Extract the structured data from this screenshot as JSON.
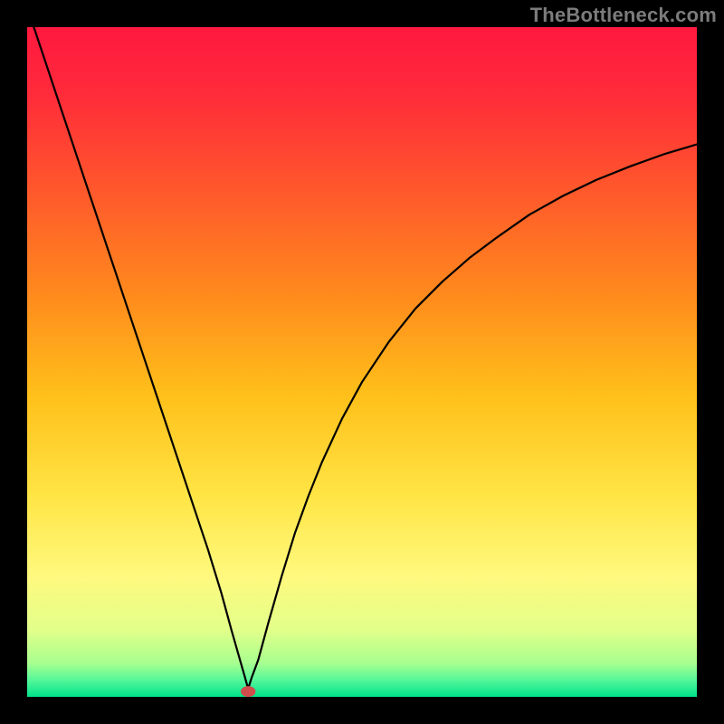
{
  "watermark": "TheBottleneck.com",
  "chart_data": {
    "type": "line",
    "title": "",
    "xlabel": "",
    "ylabel": "",
    "xlim": [
      0,
      100
    ],
    "ylim": [
      0,
      100
    ],
    "grid": false,
    "legend": false,
    "background_gradient_stops": [
      {
        "offset": 0.0,
        "color": "#ff183f"
      },
      {
        "offset": 0.1,
        "color": "#ff2b3a"
      },
      {
        "offset": 0.25,
        "color": "#ff5a2b"
      },
      {
        "offset": 0.4,
        "color": "#ff8a1d"
      },
      {
        "offset": 0.55,
        "color": "#ffc01a"
      },
      {
        "offset": 0.7,
        "color": "#ffe545"
      },
      {
        "offset": 0.82,
        "color": "#fff97e"
      },
      {
        "offset": 0.9,
        "color": "#e2ff8a"
      },
      {
        "offset": 0.95,
        "color": "#a7ff8f"
      },
      {
        "offset": 0.975,
        "color": "#55f79a"
      },
      {
        "offset": 1.0,
        "color": "#00e28a"
      }
    ],
    "series": [
      {
        "name": "bottleneck-curve",
        "mode": "polyline",
        "color": "#000000",
        "stroke_width": 2.2,
        "x": [
          1,
          3,
          5,
          7,
          9,
          11,
          13,
          15,
          17,
          19,
          21,
          23,
          25,
          27,
          29,
          30.5,
          31.5,
          32.5,
          33,
          33.5,
          34.5,
          36,
          38,
          40,
          42,
          44,
          47,
          50,
          54,
          58,
          62,
          66,
          70,
          75,
          80,
          85,
          90,
          95,
          100
        ],
        "y": [
          100,
          94,
          88,
          82,
          76,
          70,
          64,
          58,
          52,
          46,
          40,
          34,
          28,
          22,
          15.5,
          10,
          6.5,
          3,
          1.2,
          2.8,
          5.5,
          11,
          18,
          24.5,
          30,
          35,
          41.5,
          47,
          53,
          58,
          62,
          65.5,
          68.5,
          72,
          74.8,
          77.2,
          79.2,
          81,
          82.5
        ]
      }
    ],
    "marker": {
      "x": 33,
      "y": 0.8,
      "rx": 1.1,
      "ry": 0.8,
      "color": "#cf4d4d"
    }
  }
}
